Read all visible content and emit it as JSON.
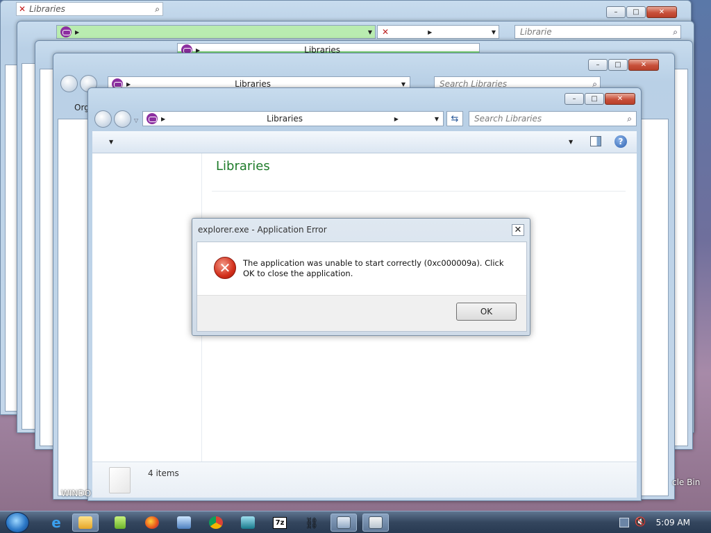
{
  "windows": {
    "back1": {
      "address": "Libraries"
    },
    "back2": {
      "search_fragment": "Librarie"
    },
    "back3": {
      "title": "Libraries"
    },
    "back4": {
      "address": "Libraries",
      "search_placeholder": "Search Libraries",
      "organize": "Org"
    },
    "main": {
      "address": "Libraries",
      "search_placeholder": "Search Libraries",
      "heading": "Libraries",
      "status": "4 items"
    }
  },
  "dialog": {
    "title": "explorer.exe - Application Error",
    "message": "The application was unable to start correctly (0xc000009a). Click OK to close the application.",
    "ok_label": "OK",
    "close_glyph": "✕"
  },
  "desktop": {
    "left_fragment": "WINDO",
    "recycle_fragment": "cle Bin"
  },
  "taskbar": {
    "clock": "5:09 AM"
  },
  "colors": {
    "accent_green": "#1e7b2a",
    "address_green": "#b9ecb0",
    "close_red": "#c8503a"
  },
  "icons": [
    "start-orb-icon",
    "ie-icon",
    "folder-icon",
    "notepad-icon",
    "firefox-icon",
    "remote-icon",
    "chrome-icon",
    "monitor-icon",
    "7zip-icon",
    "chain-icon",
    "window-icon",
    "app-icon",
    "network-icon",
    "volume-icon"
  ]
}
